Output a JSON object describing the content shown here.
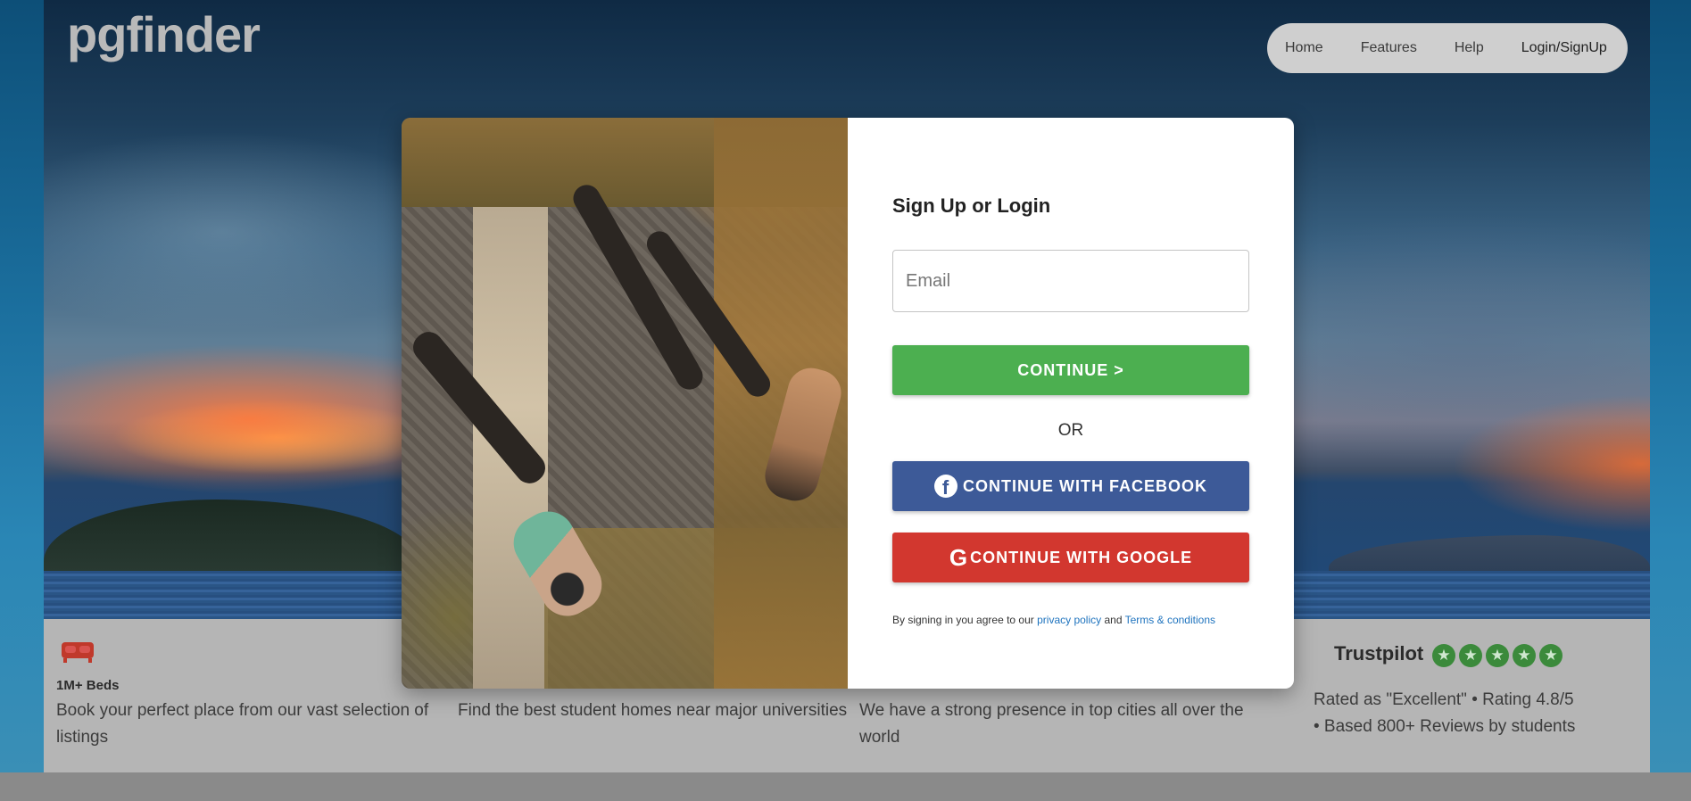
{
  "header": {
    "logo": "pgfinder",
    "nav": [
      "Home",
      "Features",
      "Help",
      "Login/SignUp"
    ]
  },
  "features": [
    {
      "icon": "bed-icon",
      "title": "1M+ Beds",
      "description": "Book your perfect place from our vast selection of listings"
    },
    {
      "title": "",
      "description": "Find the best student homes near major universities"
    },
    {
      "title": "",
      "description": "We have a strong presence in top cities all over the world"
    }
  ],
  "trustpilot": {
    "title": "Trustpilot",
    "star_count": 5,
    "line1": "Rated as \"Excellent\" • Rating 4.8/5",
    "line2": "• Based 800+ Reviews by students"
  },
  "modal": {
    "title": "Sign Up or Login",
    "email_placeholder": "Email",
    "continue_label": "CONTINUE >",
    "or_label": "OR",
    "facebook_label": "CONTINUE WITH FACEBOOK",
    "google_label": "CONTINUE WITH GOOGLE",
    "google_glyph": "G",
    "facebook_glyph": "f",
    "terms_prefix": "By signing in you agree to our ",
    "privacy_link": "privacy policy",
    "terms_and": " and ",
    "terms_link": "Terms & conditions"
  },
  "colors": {
    "continue": "#4caf50",
    "facebook": "#3d5a98",
    "google": "#d2372f",
    "link": "#1e73be"
  }
}
